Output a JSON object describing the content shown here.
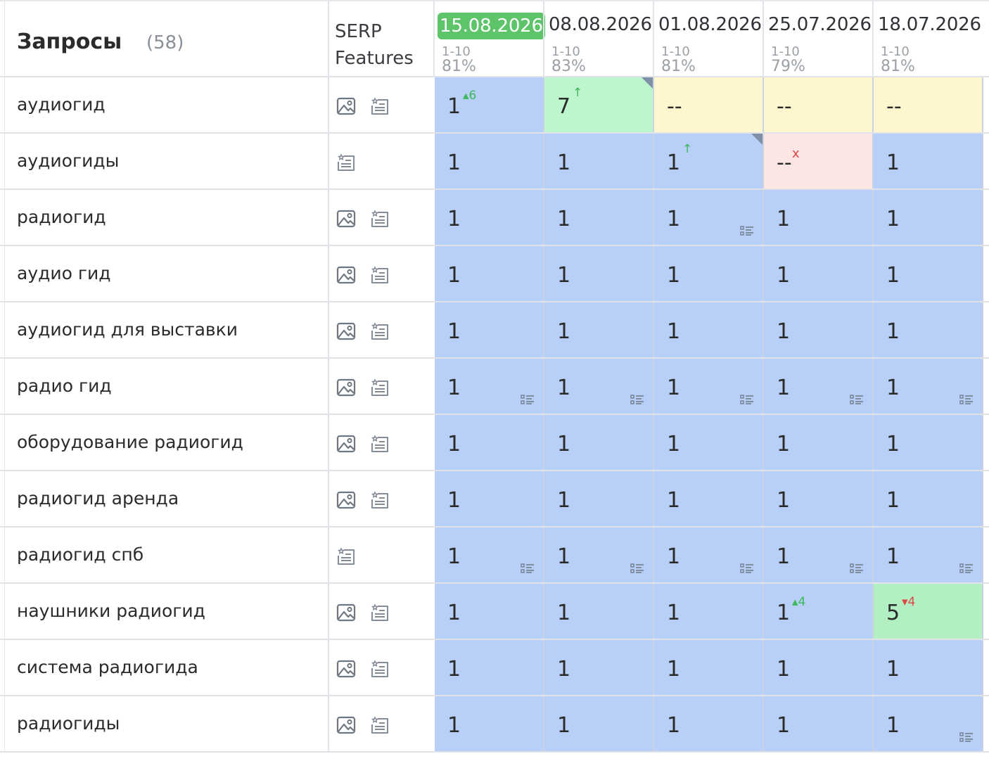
{
  "header": {
    "queries_label": "Запросы",
    "queries_count": "(58)",
    "serp_line1": "SERP",
    "serp_line2": "Features"
  },
  "dates": [
    {
      "date": "15.08.2026",
      "range": "1-10",
      "pct": "81%",
      "active": true
    },
    {
      "date": "08.08.2026",
      "range": "1-10",
      "pct": "83%",
      "active": false
    },
    {
      "date": "01.08.2026",
      "range": "1-10",
      "pct": "81%",
      "active": false
    },
    {
      "date": "25.07.2026",
      "range": "1-10",
      "pct": "79%",
      "active": false
    },
    {
      "date": "18.07.2026",
      "range": "1-10",
      "pct": "81%",
      "active": false
    }
  ],
  "rows": [
    {
      "query": "аудиогид",
      "icons": [
        "image-icon",
        "snippet-icon"
      ],
      "cells": [
        {
          "value": "1",
          "color": "blue",
          "delta": "6",
          "dir": "up"
        },
        {
          "value": "7",
          "color": "green",
          "arrow": "↑",
          "corner": true
        },
        {
          "value": "--",
          "color": "yellow"
        },
        {
          "value": "--",
          "color": "yellow"
        },
        {
          "value": "--",
          "color": "yellow"
        }
      ]
    },
    {
      "query": "аудиогиды",
      "icons": [
        "snippet-icon"
      ],
      "cells": [
        {
          "value": "1",
          "color": "blue"
        },
        {
          "value": "1",
          "color": "blue"
        },
        {
          "value": "1",
          "color": "blue",
          "arrow": "↑",
          "corner": true
        },
        {
          "value": "--",
          "color": "pink",
          "mark": "x"
        },
        {
          "value": "1",
          "color": "blue"
        }
      ]
    },
    {
      "query": "радиогид",
      "icons": [
        "image-icon",
        "snippet-icon"
      ],
      "cells": [
        {
          "value": "1",
          "color": "blue"
        },
        {
          "value": "1",
          "color": "blue"
        },
        {
          "value": "1",
          "color": "blue",
          "list": true
        },
        {
          "value": "1",
          "color": "blue"
        },
        {
          "value": "1",
          "color": "blue"
        }
      ]
    },
    {
      "query": "аудио гид",
      "icons": [
        "image-icon",
        "snippet-icon"
      ],
      "cells": [
        {
          "value": "1",
          "color": "blue"
        },
        {
          "value": "1",
          "color": "blue"
        },
        {
          "value": "1",
          "color": "blue"
        },
        {
          "value": "1",
          "color": "blue"
        },
        {
          "value": "1",
          "color": "blue"
        }
      ]
    },
    {
      "query": "аудиогид для выставки",
      "icons": [
        "image-icon",
        "snippet-icon"
      ],
      "cells": [
        {
          "value": "1",
          "color": "blue"
        },
        {
          "value": "1",
          "color": "blue"
        },
        {
          "value": "1",
          "color": "blue"
        },
        {
          "value": "1",
          "color": "blue"
        },
        {
          "value": "1",
          "color": "blue"
        }
      ]
    },
    {
      "query": "радио гид",
      "icons": [
        "image-icon",
        "snippet-icon"
      ],
      "cells": [
        {
          "value": "1",
          "color": "blue",
          "list": true
        },
        {
          "value": "1",
          "color": "blue",
          "list": true
        },
        {
          "value": "1",
          "color": "blue",
          "list": true
        },
        {
          "value": "1",
          "color": "blue",
          "list": true
        },
        {
          "value": "1",
          "color": "blue",
          "list": true
        }
      ]
    },
    {
      "query": "оборудование радиогид",
      "icons": [
        "image-icon",
        "snippet-icon"
      ],
      "cells": [
        {
          "value": "1",
          "color": "blue"
        },
        {
          "value": "1",
          "color": "blue"
        },
        {
          "value": "1",
          "color": "blue"
        },
        {
          "value": "1",
          "color": "blue"
        },
        {
          "value": "1",
          "color": "blue"
        }
      ]
    },
    {
      "query": "радиогид аренда",
      "icons": [
        "image-icon",
        "snippet-icon"
      ],
      "cells": [
        {
          "value": "1",
          "color": "blue"
        },
        {
          "value": "1",
          "color": "blue"
        },
        {
          "value": "1",
          "color": "blue"
        },
        {
          "value": "1",
          "color": "blue"
        },
        {
          "value": "1",
          "color": "blue"
        }
      ]
    },
    {
      "query": "радиогид спб",
      "icons": [
        "snippet-icon"
      ],
      "cells": [
        {
          "value": "1",
          "color": "blue",
          "list": true
        },
        {
          "value": "1",
          "color": "blue",
          "list": true
        },
        {
          "value": "1",
          "color": "blue",
          "list": true
        },
        {
          "value": "1",
          "color": "blue",
          "list": true
        },
        {
          "value": "1",
          "color": "blue",
          "list": true
        }
      ]
    },
    {
      "query": "наушники радиогид",
      "icons": [
        "image-icon",
        "snippet-icon"
      ],
      "cells": [
        {
          "value": "1",
          "color": "blue"
        },
        {
          "value": "1",
          "color": "blue"
        },
        {
          "value": "1",
          "color": "blue"
        },
        {
          "value": "1",
          "color": "blue",
          "delta": "4",
          "dir": "up"
        },
        {
          "value": "5",
          "color": "mint",
          "delta": "4",
          "dir": "down"
        }
      ]
    },
    {
      "query": "система радиогида",
      "icons": [
        "image-icon",
        "snippet-icon"
      ],
      "cells": [
        {
          "value": "1",
          "color": "blue"
        },
        {
          "value": "1",
          "color": "blue"
        },
        {
          "value": "1",
          "color": "blue"
        },
        {
          "value": "1",
          "color": "blue"
        },
        {
          "value": "1",
          "color": "blue"
        }
      ]
    },
    {
      "query": "радиогиды",
      "icons": [
        "image-icon",
        "snippet-icon"
      ],
      "cells": [
        {
          "value": "1",
          "color": "blue"
        },
        {
          "value": "1",
          "color": "blue"
        },
        {
          "value": "1",
          "color": "blue"
        },
        {
          "value": "1",
          "color": "blue"
        },
        {
          "value": "1",
          "color": "blue",
          "list": true
        }
      ]
    }
  ]
}
